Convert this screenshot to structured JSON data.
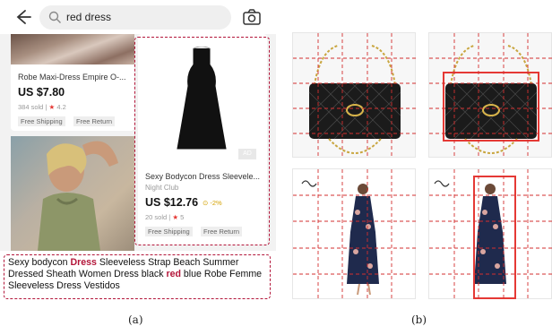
{
  "search": {
    "query": "red dress"
  },
  "products": [
    {
      "title": "Robe Maxi-Dress Empire O-...",
      "price": "US $7.80",
      "sold": "384 sold",
      "rating": "4.2",
      "tags": [
        "Free Shipping",
        "Free Return"
      ]
    },
    {
      "title": "Sexy Bodycon Dress Sleevele...",
      "store": "Night Club",
      "price": "US $12.76",
      "discount": "-2%",
      "sold": "20 sold",
      "rating": "5",
      "ad": "AD",
      "tags": [
        "Free Shipping",
        "Free Return"
      ]
    }
  ],
  "caption": {
    "parts": [
      {
        "text": "Sexy bodycon ",
        "hl": false
      },
      {
        "text": "Dress",
        "hl": true
      },
      {
        "text": " Sleeveless Strap Beach Summer Dressed Sheath Women Dress black ",
        "hl": false
      },
      {
        "text": "red",
        "hl": true
      },
      {
        "text": " blue Robe Femme Sleeveless Dress Vestidos",
        "hl": false
      }
    ]
  },
  "labels": {
    "a": "(a)",
    "b": "(b)"
  },
  "colors": {
    "highlight": "#b3163a",
    "grid_line": "#d32f2f",
    "box": "#e53935"
  }
}
